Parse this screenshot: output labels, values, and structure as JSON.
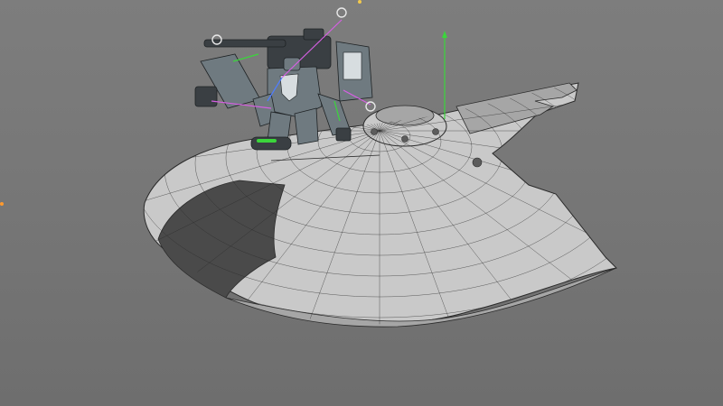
{
  "viewport": {
    "background_color": "#7a7a7a"
  },
  "scene": {
    "model": {
      "hull_fill": "#c9c9c9",
      "hull_shadow": "#a6a6a6",
      "hull_dark": "#5c5c5c",
      "wire_color": "#2b2b2b",
      "cutout_fill": "#4a4a4a"
    },
    "mech": {
      "armor_color": "#6f7a80",
      "armor_dark": "#3a3f43",
      "accent": "#d7dde0"
    },
    "gizmo": {
      "x_axis_color": "#d65fe3",
      "y_axis_color": "#3bd63b",
      "z_axis_color": "#4f7dff",
      "handle_color": "#e8e8e8"
    },
    "markers": {
      "orange": "#ff9a2e",
      "yellow": "#f2c94c"
    }
  }
}
